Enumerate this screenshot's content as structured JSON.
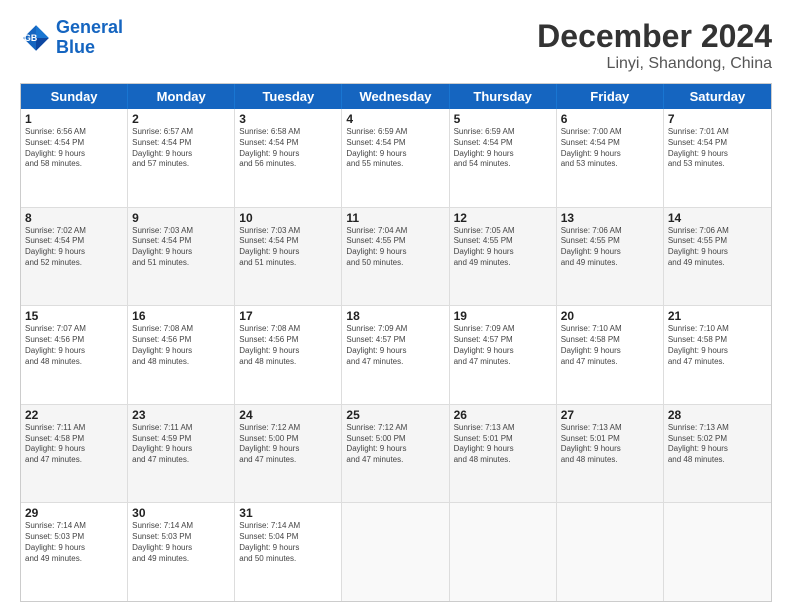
{
  "header": {
    "logo_general": "General",
    "logo_blue": "Blue",
    "main_title": "December 2024",
    "subtitle": "Linyi, Shandong, China"
  },
  "weekdays": [
    "Sunday",
    "Monday",
    "Tuesday",
    "Wednesday",
    "Thursday",
    "Friday",
    "Saturday"
  ],
  "rows": [
    [
      {
        "day": "1",
        "info": "Sunrise: 6:56 AM\nSunset: 4:54 PM\nDaylight: 9 hours\nand 58 minutes.",
        "shaded": false
      },
      {
        "day": "2",
        "info": "Sunrise: 6:57 AM\nSunset: 4:54 PM\nDaylight: 9 hours\nand 57 minutes.",
        "shaded": false
      },
      {
        "day": "3",
        "info": "Sunrise: 6:58 AM\nSunset: 4:54 PM\nDaylight: 9 hours\nand 56 minutes.",
        "shaded": false
      },
      {
        "day": "4",
        "info": "Sunrise: 6:59 AM\nSunset: 4:54 PM\nDaylight: 9 hours\nand 55 minutes.",
        "shaded": false
      },
      {
        "day": "5",
        "info": "Sunrise: 6:59 AM\nSunset: 4:54 PM\nDaylight: 9 hours\nand 54 minutes.",
        "shaded": false
      },
      {
        "day": "6",
        "info": "Sunrise: 7:00 AM\nSunset: 4:54 PM\nDaylight: 9 hours\nand 53 minutes.",
        "shaded": false
      },
      {
        "day": "7",
        "info": "Sunrise: 7:01 AM\nSunset: 4:54 PM\nDaylight: 9 hours\nand 53 minutes.",
        "shaded": false
      }
    ],
    [
      {
        "day": "8",
        "info": "Sunrise: 7:02 AM\nSunset: 4:54 PM\nDaylight: 9 hours\nand 52 minutes.",
        "shaded": true
      },
      {
        "day": "9",
        "info": "Sunrise: 7:03 AM\nSunset: 4:54 PM\nDaylight: 9 hours\nand 51 minutes.",
        "shaded": true
      },
      {
        "day": "10",
        "info": "Sunrise: 7:03 AM\nSunset: 4:54 PM\nDaylight: 9 hours\nand 51 minutes.",
        "shaded": true
      },
      {
        "day": "11",
        "info": "Sunrise: 7:04 AM\nSunset: 4:55 PM\nDaylight: 9 hours\nand 50 minutes.",
        "shaded": true
      },
      {
        "day": "12",
        "info": "Sunrise: 7:05 AM\nSunset: 4:55 PM\nDaylight: 9 hours\nand 49 minutes.",
        "shaded": true
      },
      {
        "day": "13",
        "info": "Sunrise: 7:06 AM\nSunset: 4:55 PM\nDaylight: 9 hours\nand 49 minutes.",
        "shaded": true
      },
      {
        "day": "14",
        "info": "Sunrise: 7:06 AM\nSunset: 4:55 PM\nDaylight: 9 hours\nand 49 minutes.",
        "shaded": true
      }
    ],
    [
      {
        "day": "15",
        "info": "Sunrise: 7:07 AM\nSunset: 4:56 PM\nDaylight: 9 hours\nand 48 minutes.",
        "shaded": false
      },
      {
        "day": "16",
        "info": "Sunrise: 7:08 AM\nSunset: 4:56 PM\nDaylight: 9 hours\nand 48 minutes.",
        "shaded": false
      },
      {
        "day": "17",
        "info": "Sunrise: 7:08 AM\nSunset: 4:56 PM\nDaylight: 9 hours\nand 48 minutes.",
        "shaded": false
      },
      {
        "day": "18",
        "info": "Sunrise: 7:09 AM\nSunset: 4:57 PM\nDaylight: 9 hours\nand 47 minutes.",
        "shaded": false
      },
      {
        "day": "19",
        "info": "Sunrise: 7:09 AM\nSunset: 4:57 PM\nDaylight: 9 hours\nand 47 minutes.",
        "shaded": false
      },
      {
        "day": "20",
        "info": "Sunrise: 7:10 AM\nSunset: 4:58 PM\nDaylight: 9 hours\nand 47 minutes.",
        "shaded": false
      },
      {
        "day": "21",
        "info": "Sunrise: 7:10 AM\nSunset: 4:58 PM\nDaylight: 9 hours\nand 47 minutes.",
        "shaded": false
      }
    ],
    [
      {
        "day": "22",
        "info": "Sunrise: 7:11 AM\nSunset: 4:58 PM\nDaylight: 9 hours\nand 47 minutes.",
        "shaded": true
      },
      {
        "day": "23",
        "info": "Sunrise: 7:11 AM\nSunset: 4:59 PM\nDaylight: 9 hours\nand 47 minutes.",
        "shaded": true
      },
      {
        "day": "24",
        "info": "Sunrise: 7:12 AM\nSunset: 5:00 PM\nDaylight: 9 hours\nand 47 minutes.",
        "shaded": true
      },
      {
        "day": "25",
        "info": "Sunrise: 7:12 AM\nSunset: 5:00 PM\nDaylight: 9 hours\nand 47 minutes.",
        "shaded": true
      },
      {
        "day": "26",
        "info": "Sunrise: 7:13 AM\nSunset: 5:01 PM\nDaylight: 9 hours\nand 48 minutes.",
        "shaded": true
      },
      {
        "day": "27",
        "info": "Sunrise: 7:13 AM\nSunset: 5:01 PM\nDaylight: 9 hours\nand 48 minutes.",
        "shaded": true
      },
      {
        "day": "28",
        "info": "Sunrise: 7:13 AM\nSunset: 5:02 PM\nDaylight: 9 hours\nand 48 minutes.",
        "shaded": true
      }
    ],
    [
      {
        "day": "29",
        "info": "Sunrise: 7:14 AM\nSunset: 5:03 PM\nDaylight: 9 hours\nand 49 minutes.",
        "shaded": false
      },
      {
        "day": "30",
        "info": "Sunrise: 7:14 AM\nSunset: 5:03 PM\nDaylight: 9 hours\nand 49 minutes.",
        "shaded": false
      },
      {
        "day": "31",
        "info": "Sunrise: 7:14 AM\nSunset: 5:04 PM\nDaylight: 9 hours\nand 50 minutes.",
        "shaded": false
      },
      {
        "day": "",
        "info": "",
        "shaded": false,
        "empty": true
      },
      {
        "day": "",
        "info": "",
        "shaded": false,
        "empty": true
      },
      {
        "day": "",
        "info": "",
        "shaded": false,
        "empty": true
      },
      {
        "day": "",
        "info": "",
        "shaded": false,
        "empty": true
      }
    ]
  ]
}
